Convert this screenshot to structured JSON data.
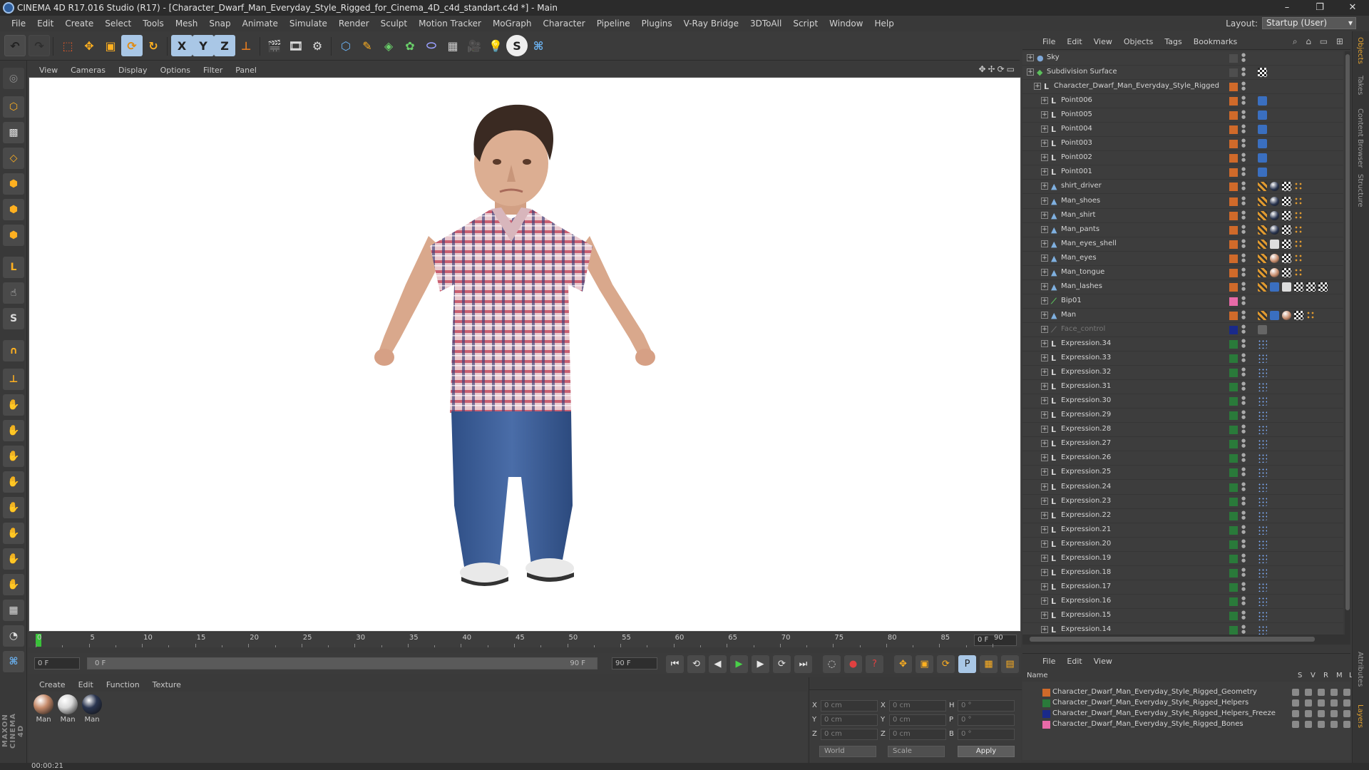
{
  "window": {
    "title": "CINEMA 4D R17.016 Studio (R17) - [Character_Dwarf_Man_Everyday_Style_Rigged_for_Cinema_4D_c4d_standart.c4d *] - Main",
    "controls": [
      "–",
      "❐",
      "✕"
    ]
  },
  "menubar": {
    "items": [
      "File",
      "Edit",
      "Create",
      "Select",
      "Tools",
      "Mesh",
      "Snap",
      "Animate",
      "Simulate",
      "Render",
      "Sculpt",
      "Motion Tracker",
      "MoGraph",
      "Character",
      "Pipeline",
      "Plugins",
      "V-Ray Bridge",
      "3DToAll",
      "Script",
      "Window",
      "Help"
    ],
    "layout_label": "Layout:",
    "layout_value": "Startup (User)"
  },
  "toolbar": {
    "axis_x": "X",
    "axis_y": "Y",
    "axis_z": "Z"
  },
  "viewport": {
    "menu": [
      "View",
      "Cameras",
      "Display",
      "Options",
      "Filter",
      "Panel"
    ]
  },
  "timeline": {
    "ticks": [
      "0",
      "5",
      "10",
      "15",
      "20",
      "25",
      "30",
      "35",
      "40",
      "45",
      "50",
      "55",
      "60",
      "65",
      "70",
      "75",
      "80",
      "85",
      "90"
    ],
    "current_frame": "0 F",
    "start_field": "0 F",
    "slider_start": "0 F",
    "slider_end": "90 F",
    "end_field": "90 F"
  },
  "material_manager": {
    "menu": [
      "Create",
      "Edit",
      "Function",
      "Texture"
    ],
    "materials": [
      {
        "label": "Man",
        "color": "#c58a6a"
      },
      {
        "label": "Man",
        "color": "#d8d8d8"
      },
      {
        "label": "Man",
        "color": "#2a3550"
      }
    ]
  },
  "coordinates": {
    "rows": [
      {
        "a_label": "X",
        "a_value": "0 cm",
        "b_label": "X",
        "b_value": "0 cm",
        "c_label": "H",
        "c_value": "0 °"
      },
      {
        "a_label": "Y",
        "a_value": "0 cm",
        "b_label": "Y",
        "b_value": "0 cm",
        "c_label": "P",
        "c_value": "0 °"
      },
      {
        "a_label": "Z",
        "a_value": "0 cm",
        "b_label": "Z",
        "b_value": "0 cm",
        "c_label": "B",
        "c_value": "0 °"
      }
    ],
    "mode": "World",
    "scale": "Scale",
    "apply": "Apply"
  },
  "status": {
    "time": "00:00:21"
  },
  "object_manager": {
    "menu": [
      "File",
      "Edit",
      "View",
      "Objects",
      "Tags",
      "Bookmarks"
    ],
    "rows": [
      {
        "name": "Sky",
        "level": 0,
        "icon": "●",
        "icon_color": "#7fa8d8",
        "layer": "",
        "tags": []
      },
      {
        "name": "Subdivision Surface",
        "level": 0,
        "icon": "◆",
        "icon_color": "#5cc05c",
        "layer": "",
        "tags": [
          "check"
        ]
      },
      {
        "name": "Character_Dwarf_Man_Everyday_Style_Rigged",
        "level": 1,
        "icon": "L",
        "icon_color": "#d4d4d4",
        "layer": "#d06a2a",
        "tags": []
      },
      {
        "name": "Point006",
        "level": 2,
        "icon": "L",
        "icon_color": "#d4d4d4",
        "layer": "#d06a2a",
        "tags": [
          "pin"
        ]
      },
      {
        "name": "Point005",
        "level": 2,
        "icon": "L",
        "icon_color": "#d4d4d4",
        "layer": "#d06a2a",
        "tags": [
          "pin"
        ]
      },
      {
        "name": "Point004",
        "level": 2,
        "icon": "L",
        "icon_color": "#d4d4d4",
        "layer": "#d06a2a",
        "tags": [
          "pin"
        ]
      },
      {
        "name": "Point003",
        "level": 2,
        "icon": "L",
        "icon_color": "#d4d4d4",
        "layer": "#d06a2a",
        "tags": [
          "pin"
        ]
      },
      {
        "name": "Point002",
        "level": 2,
        "icon": "L",
        "icon_color": "#d4d4d4",
        "layer": "#d06a2a",
        "tags": [
          "pin"
        ]
      },
      {
        "name": "Point001",
        "level": 2,
        "icon": "L",
        "icon_color": "#d4d4d4",
        "layer": "#d06a2a",
        "tags": [
          "pin"
        ]
      },
      {
        "name": "shirt_driver",
        "level": 2,
        "icon": "▲",
        "icon_color": "#7fb0e0",
        "layer": "#d06a2a",
        "tags": [
          "grid",
          "ball",
          "check",
          "dots"
        ]
      },
      {
        "name": "Man_shoes",
        "level": 2,
        "icon": "▲",
        "icon_color": "#7fb0e0",
        "layer": "#d06a2a",
        "tags": [
          "grid",
          "ball",
          "check",
          "dots"
        ]
      },
      {
        "name": "Man_shirt",
        "level": 2,
        "icon": "▲",
        "icon_color": "#7fb0e0",
        "layer": "#d06a2a",
        "tags": [
          "grid",
          "ball",
          "check",
          "dots"
        ]
      },
      {
        "name": "Man_pants",
        "level": 2,
        "icon": "▲",
        "icon_color": "#7fb0e0",
        "layer": "#d06a2a",
        "tags": [
          "grid",
          "ball",
          "check",
          "dots"
        ]
      },
      {
        "name": "Man_eyes_shell",
        "level": 2,
        "icon": "▲",
        "icon_color": "#7fb0e0",
        "layer": "#d06a2a",
        "tags": [
          "grid",
          "white",
          "check",
          "dots"
        ]
      },
      {
        "name": "Man_eyes",
        "level": 2,
        "icon": "▲",
        "icon_color": "#7fb0e0",
        "layer": "#d06a2a",
        "tags": [
          "grid",
          "skin",
          "check",
          "dots"
        ]
      },
      {
        "name": "Man_tongue",
        "level": 2,
        "icon": "▲",
        "icon_color": "#7fb0e0",
        "layer": "#d06a2a",
        "tags": [
          "grid",
          "skin",
          "check",
          "dots"
        ]
      },
      {
        "name": "Man_lashes",
        "level": 2,
        "icon": "▲",
        "icon_color": "#7fb0e0",
        "layer": "#d06a2a",
        "tags": [
          "grid",
          "pin",
          "white",
          "check",
          "check",
          "check"
        ]
      },
      {
        "name": "Bip01",
        "level": 2,
        "icon": "⟋",
        "icon_color": "#5cc05c",
        "layer": "#e86aa8",
        "tags": []
      },
      {
        "name": "Man",
        "level": 2,
        "icon": "▲",
        "icon_color": "#7fb0e0",
        "layer": "#d06a2a",
        "tags": [
          "grid",
          "pin",
          "skin",
          "check",
          "dots"
        ]
      },
      {
        "name": "Face_control",
        "level": 2,
        "icon": "⟋",
        "icon_color": "#6a6a6a",
        "layer": "#1a2a8a",
        "tags": [
          "gray"
        ],
        "dim": true
      },
      {
        "name": "Expression.34",
        "level": 2,
        "icon": "L",
        "icon_color": "#d4d4d4",
        "layer": "#2a7a3a",
        "tags": [
          "expr"
        ]
      },
      {
        "name": "Expression.33",
        "level": 2,
        "icon": "L",
        "icon_color": "#d4d4d4",
        "layer": "#2a7a3a",
        "tags": [
          "expr"
        ]
      },
      {
        "name": "Expression.32",
        "level": 2,
        "icon": "L",
        "icon_color": "#d4d4d4",
        "layer": "#2a7a3a",
        "tags": [
          "expr"
        ]
      },
      {
        "name": "Expression.31",
        "level": 2,
        "icon": "L",
        "icon_color": "#d4d4d4",
        "layer": "#2a7a3a",
        "tags": [
          "expr"
        ]
      },
      {
        "name": "Expression.30",
        "level": 2,
        "icon": "L",
        "icon_color": "#d4d4d4",
        "layer": "#2a7a3a",
        "tags": [
          "expr"
        ]
      },
      {
        "name": "Expression.29",
        "level": 2,
        "icon": "L",
        "icon_color": "#d4d4d4",
        "layer": "#2a7a3a",
        "tags": [
          "expr"
        ]
      },
      {
        "name": "Expression.28",
        "level": 2,
        "icon": "L",
        "icon_color": "#d4d4d4",
        "layer": "#2a7a3a",
        "tags": [
          "expr"
        ]
      },
      {
        "name": "Expression.27",
        "level": 2,
        "icon": "L",
        "icon_color": "#d4d4d4",
        "layer": "#2a7a3a",
        "tags": [
          "expr"
        ]
      },
      {
        "name": "Expression.26",
        "level": 2,
        "icon": "L",
        "icon_color": "#d4d4d4",
        "layer": "#2a7a3a",
        "tags": [
          "expr"
        ]
      },
      {
        "name": "Expression.25",
        "level": 2,
        "icon": "L",
        "icon_color": "#d4d4d4",
        "layer": "#2a7a3a",
        "tags": [
          "expr"
        ]
      },
      {
        "name": "Expression.24",
        "level": 2,
        "icon": "L",
        "icon_color": "#d4d4d4",
        "layer": "#2a7a3a",
        "tags": [
          "expr"
        ]
      },
      {
        "name": "Expression.23",
        "level": 2,
        "icon": "L",
        "icon_color": "#d4d4d4",
        "layer": "#2a7a3a",
        "tags": [
          "expr"
        ]
      },
      {
        "name": "Expression.22",
        "level": 2,
        "icon": "L",
        "icon_color": "#d4d4d4",
        "layer": "#2a7a3a",
        "tags": [
          "expr"
        ]
      },
      {
        "name": "Expression.21",
        "level": 2,
        "icon": "L",
        "icon_color": "#d4d4d4",
        "layer": "#2a7a3a",
        "tags": [
          "expr"
        ]
      },
      {
        "name": "Expression.20",
        "level": 2,
        "icon": "L",
        "icon_color": "#d4d4d4",
        "layer": "#2a7a3a",
        "tags": [
          "expr"
        ]
      },
      {
        "name": "Expression.19",
        "level": 2,
        "icon": "L",
        "icon_color": "#d4d4d4",
        "layer": "#2a7a3a",
        "tags": [
          "expr"
        ]
      },
      {
        "name": "Expression.18",
        "level": 2,
        "icon": "L",
        "icon_color": "#d4d4d4",
        "layer": "#2a7a3a",
        "tags": [
          "expr"
        ]
      },
      {
        "name": "Expression.17",
        "level": 2,
        "icon": "L",
        "icon_color": "#d4d4d4",
        "layer": "#2a7a3a",
        "tags": [
          "expr"
        ]
      },
      {
        "name": "Expression.16",
        "level": 2,
        "icon": "L",
        "icon_color": "#d4d4d4",
        "layer": "#2a7a3a",
        "tags": [
          "expr"
        ]
      },
      {
        "name": "Expression.15",
        "level": 2,
        "icon": "L",
        "icon_color": "#d4d4d4",
        "layer": "#2a7a3a",
        "tags": [
          "expr"
        ]
      },
      {
        "name": "Expression.14",
        "level": 2,
        "icon": "L",
        "icon_color": "#d4d4d4",
        "layer": "#2a7a3a",
        "tags": [
          "expr"
        ]
      }
    ]
  },
  "layer_manager": {
    "menu": [
      "File",
      "Edit",
      "View"
    ],
    "columns": [
      "Name",
      "S",
      "V",
      "R",
      "M",
      "L"
    ],
    "layers": [
      {
        "name": "Character_Dwarf_Man_Everyday_Style_Rigged_Geometry",
        "color": "#d06a2a"
      },
      {
        "name": "Character_Dwarf_Man_Everyday_Style_Rigged_Helpers",
        "color": "#2a7a3a"
      },
      {
        "name": "Character_Dwarf_Man_Everyday_Style_Rigged_Helpers_Freeze",
        "color": "#1a2a8a"
      },
      {
        "name": "Character_Dwarf_Man_Everyday_Style_Rigged_Bones",
        "color": "#e86aa8"
      }
    ]
  },
  "side_tabs": [
    "Objects",
    "Takes",
    "Content Browser",
    "Structure",
    "Attributes",
    "Layers"
  ],
  "brand": "MAXON CINEMA 4D"
}
